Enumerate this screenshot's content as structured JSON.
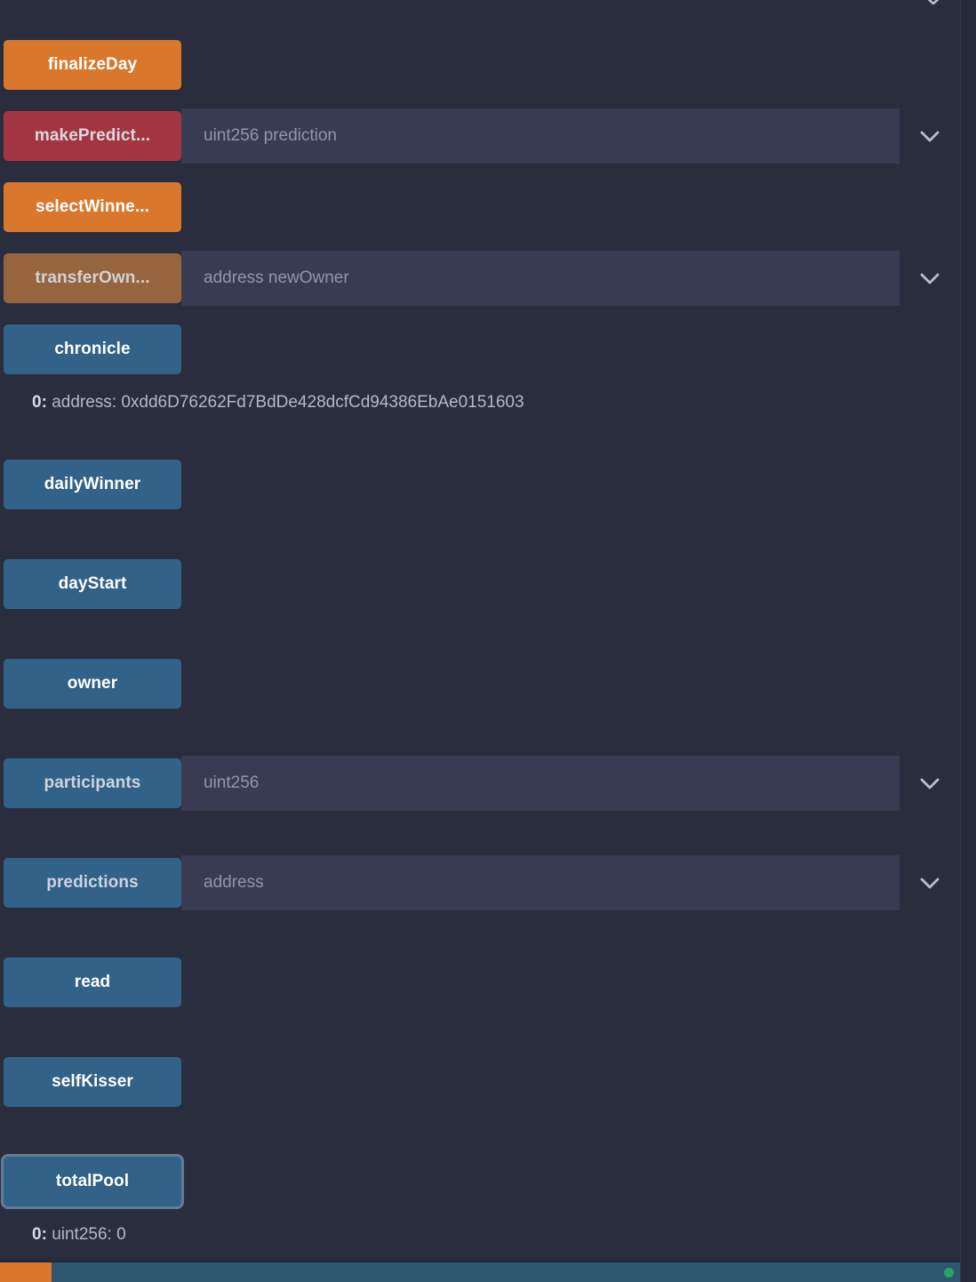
{
  "panel": {
    "name": "deployed-contract-functions"
  },
  "colors": {
    "panel_bg": "#2a2d3e",
    "input_bg": "#383b52",
    "transact_orange": "#d9782d",
    "transact_payable_red": "#a33541",
    "transact_muted_brown": "#96653d",
    "call_blue": "#326287",
    "result_text": "#b3b8ca",
    "status_online_green": "#25a55f",
    "status_bar_bg": "#2f5670"
  },
  "functions": [
    {
      "label": "finalizeDay",
      "kind": "transact",
      "style": "orange",
      "has_input": false,
      "input_placeholder": "",
      "has_expand": false,
      "focused": false,
      "result": null
    },
    {
      "label": "makePredict...",
      "kind": "transact-payable",
      "style": "red",
      "has_input": true,
      "input_placeholder": "uint256 prediction",
      "input_value": "",
      "has_expand": true,
      "focused": false,
      "result": null
    },
    {
      "label": "selectWinne...",
      "kind": "transact",
      "style": "orange",
      "has_input": false,
      "input_placeholder": "",
      "has_expand": false,
      "focused": false,
      "result": null
    },
    {
      "label": "transferOwn...",
      "kind": "transact",
      "style": "brown",
      "has_input": true,
      "input_placeholder": "address newOwner",
      "input_value": "",
      "has_expand": true,
      "focused": false,
      "result": null
    },
    {
      "label": "chronicle",
      "kind": "call",
      "style": "blue",
      "has_input": false,
      "input_placeholder": "",
      "has_expand": false,
      "focused": false,
      "result": {
        "index": "0:",
        "text": "address: 0xdd6D76262Fd7BdDe428dcfCd94386EbAe0151603"
      }
    },
    {
      "label": "dailyWinner",
      "kind": "call",
      "style": "blue",
      "has_input": false,
      "input_placeholder": "",
      "has_expand": false,
      "focused": false,
      "result": null
    },
    {
      "label": "dayStart",
      "kind": "call",
      "style": "blue",
      "has_input": false,
      "input_placeholder": "",
      "has_expand": false,
      "focused": false,
      "result": null
    },
    {
      "label": "owner",
      "kind": "call",
      "style": "blue",
      "has_input": false,
      "input_placeholder": "",
      "has_expand": false,
      "focused": false,
      "result": null
    },
    {
      "label": "participants",
      "kind": "call",
      "style": "blue muted",
      "has_input": true,
      "input_placeholder": "uint256",
      "input_value": "",
      "has_expand": true,
      "focused": false,
      "result": null
    },
    {
      "label": "predictions",
      "kind": "call",
      "style": "blue muted",
      "has_input": true,
      "input_placeholder": "address",
      "input_value": "",
      "has_expand": true,
      "focused": false,
      "result": null
    },
    {
      "label": "read",
      "kind": "call",
      "style": "blue",
      "has_input": false,
      "input_placeholder": "",
      "has_expand": false,
      "focused": false,
      "result": null
    },
    {
      "label": "selfKisser",
      "kind": "call",
      "style": "blue",
      "has_input": false,
      "input_placeholder": "",
      "has_expand": false,
      "focused": false,
      "result": null
    },
    {
      "label": "totalPool",
      "kind": "call",
      "style": "blue",
      "has_input": false,
      "input_placeholder": "",
      "has_expand": false,
      "focused": true,
      "result": {
        "index": "0:",
        "text": "uint256: 0"
      }
    }
  ],
  "status_bar": {
    "accent_label": "",
    "left_label": "",
    "right_label": ""
  }
}
